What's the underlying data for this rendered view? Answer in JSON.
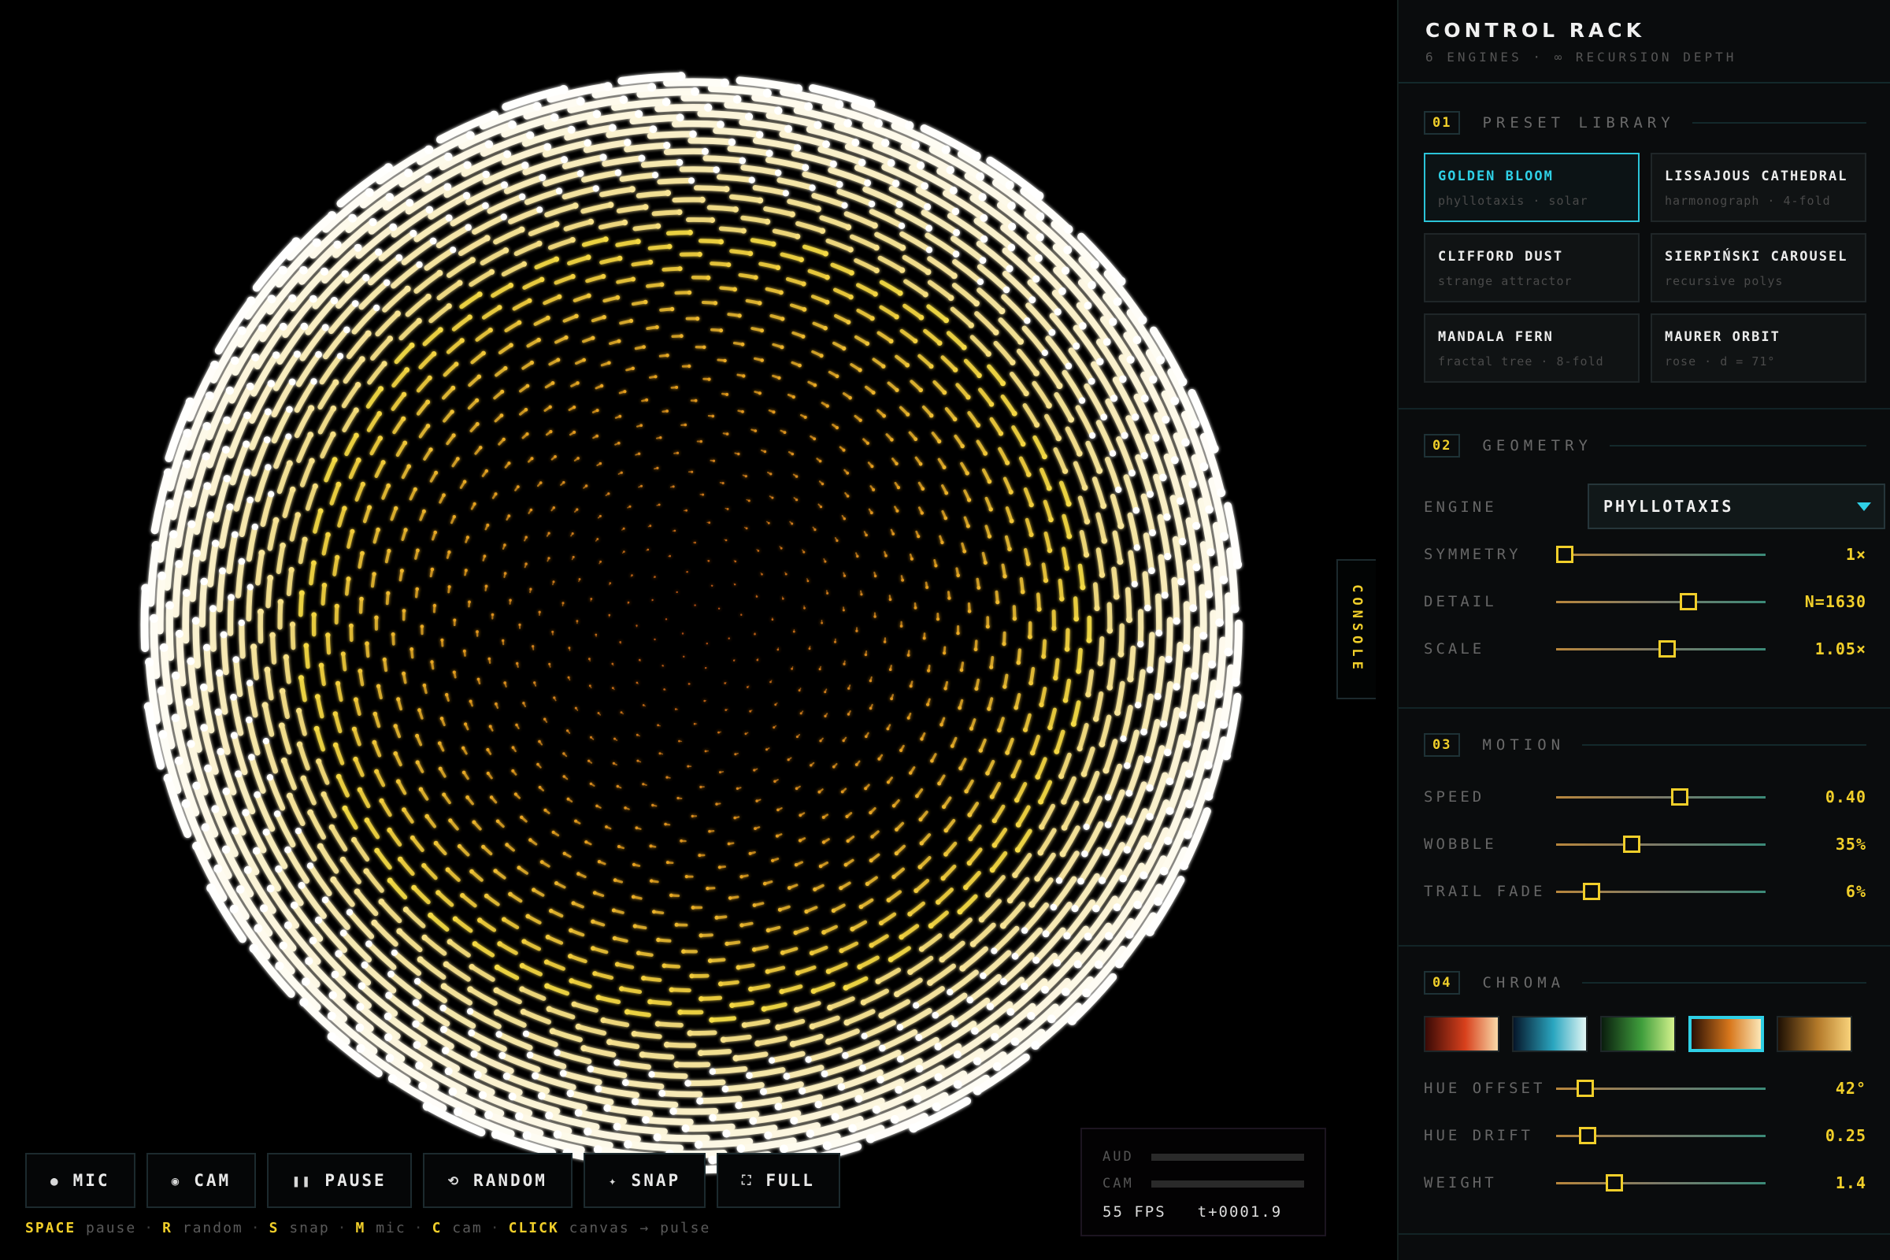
{
  "colors": {
    "accent": "#f1cf2a",
    "active": "#2fd0e6"
  },
  "toolbar": {
    "buttons": [
      {
        "icon": "dot-icon",
        "glyph": "●",
        "label": "MIC"
      },
      {
        "icon": "camera-icon",
        "glyph": "◉",
        "label": "CAM"
      },
      {
        "icon": "pause-icon",
        "glyph": "❚❚",
        "label": "PAUSE"
      },
      {
        "icon": "random-icon",
        "glyph": "⟲",
        "label": "RANDOM"
      },
      {
        "icon": "sparkle-icon",
        "glyph": "✦",
        "label": "SNAP"
      },
      {
        "icon": "fullscreen-icon",
        "glyph": "⛶",
        "label": "FULL"
      }
    ]
  },
  "hint": [
    {
      "key": "SPACE",
      "desc": "pause"
    },
    {
      "key": "R",
      "desc": "random"
    },
    {
      "key": "S",
      "desc": "snap"
    },
    {
      "key": "M",
      "desc": "mic"
    },
    {
      "key": "C",
      "desc": "cam"
    },
    {
      "key": "CLICK",
      "desc": "canvas → pulse"
    }
  ],
  "meter": {
    "aud_label": "AUD",
    "cam_label": "CAM",
    "fps": "55 FPS",
    "time": "t+0001.9"
  },
  "console_label": "CONSOLE",
  "panel": {
    "title": "CONTROL RACK",
    "subtitle": "6 ENGINES · ∞ RECURSION DEPTH",
    "presets": {
      "num": "01",
      "name": "PRESET LIBRARY",
      "items": [
        {
          "name": "GOLDEN BLOOM",
          "desc": "phyllotaxis · solar",
          "active": true
        },
        {
          "name": "LISSAJOUS CATHEDRAL",
          "desc": "harmonograph · 4-fold",
          "active": false
        },
        {
          "name": "CLIFFORD DUST",
          "desc": "strange attractor",
          "active": false
        },
        {
          "name": "SIERPIŃSKI CAROUSEL",
          "desc": "recursive polys",
          "active": false
        },
        {
          "name": "MANDALA FERN",
          "desc": "fractal tree · 8-fold",
          "active": false
        },
        {
          "name": "MAURER ORBIT",
          "desc": "rose · d = 71°",
          "active": false
        }
      ]
    },
    "geometry": {
      "num": "02",
      "name": "GEOMETRY",
      "engine_label": "ENGINE",
      "engine_value": "PHYLLOTAXIS",
      "sliders": [
        {
          "label": "SYMMETRY",
          "value": "1×",
          "pos": 0.04
        },
        {
          "label": "DETAIL",
          "value": "N=1630",
          "pos": 0.63
        },
        {
          "label": "SCALE",
          "value": "1.05×",
          "pos": 0.53
        }
      ]
    },
    "motion": {
      "num": "03",
      "name": "MOTION",
      "sliders": [
        {
          "label": "SPEED",
          "value": "0.40",
          "pos": 0.59
        },
        {
          "label": "WOBBLE",
          "value": "35%",
          "pos": 0.36
        },
        {
          "label": "TRAIL FADE",
          "value": "6%",
          "pos": 0.17
        }
      ]
    },
    "chroma": {
      "num": "04",
      "name": "CHROMA",
      "palettes": [
        {
          "name": "ember",
          "from": "#3a0a06",
          "mid": "#d8401c",
          "to": "#f8d9a8",
          "active": false
        },
        {
          "name": "ocean",
          "from": "#06162a",
          "mid": "#2aa6c0",
          "to": "#e2f6f4",
          "active": false
        },
        {
          "name": "forest",
          "from": "#0a1e0e",
          "mid": "#3f9e3c",
          "to": "#d4f28c",
          "active": false
        },
        {
          "name": "solar",
          "from": "#2a1004",
          "mid": "#d8771c",
          "to": "#fbe7b8",
          "active": true
        },
        {
          "name": "gold",
          "from": "#1e1004",
          "mid": "#b47a2a",
          "to": "#f8d27a",
          "active": false
        }
      ],
      "sliders": [
        {
          "label": "HUE OFFSET",
          "value": "42°",
          "pos": 0.14
        },
        {
          "label": "HUE DRIFT",
          "value": "0.25",
          "pos": 0.15
        },
        {
          "label": "WEIGHT",
          "value": "1.4",
          "pos": 0.28
        }
      ]
    }
  }
}
